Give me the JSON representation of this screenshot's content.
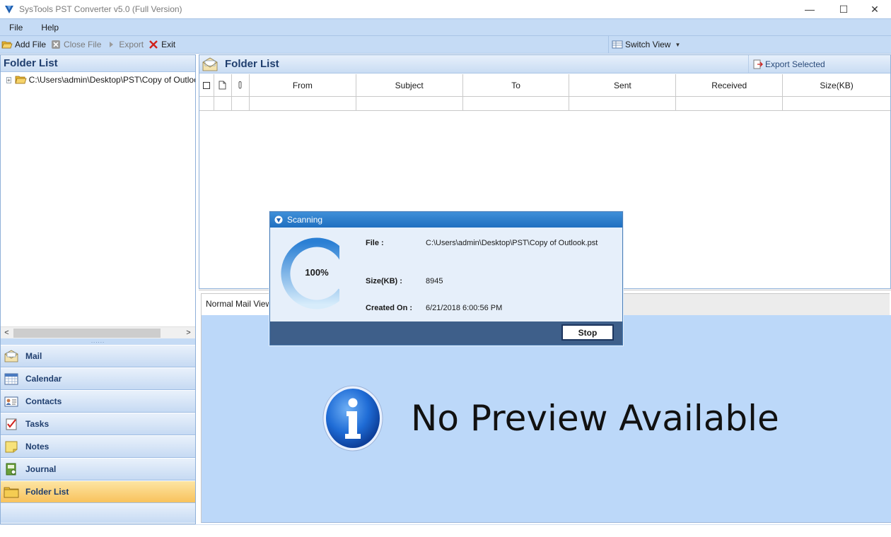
{
  "window": {
    "title": "SysTools  PST Converter v5.0 (Full Version)",
    "minimize_glyph": "—",
    "maximize_glyph": "☐",
    "close_glyph": "✕"
  },
  "menu": [
    "File",
    "Help"
  ],
  "toolbar": {
    "add_file": "Add File",
    "close_file": "Close File",
    "export": "Export",
    "exit": "Exit",
    "switch_view": "Switch View"
  },
  "left_panel": {
    "header": "Folder List",
    "tree": [
      {
        "expander": "+",
        "label": "C:\\Users\\admin\\Desktop\\PST\\Copy of Outlook.pst"
      }
    ],
    "scroll_left": "<",
    "scroll_right": ">",
    "splitter_grip": "......",
    "nav": [
      {
        "label": "Mail",
        "icon": "mail-icon",
        "active": false
      },
      {
        "label": "Calendar",
        "icon": "calendar-icon",
        "active": false
      },
      {
        "label": "Contacts",
        "icon": "contacts-icon",
        "active": false
      },
      {
        "label": "Tasks",
        "icon": "tasks-icon",
        "active": false
      },
      {
        "label": "Notes",
        "icon": "notes-icon",
        "active": false
      },
      {
        "label": "Journal",
        "icon": "journal-icon",
        "active": false
      },
      {
        "label": "Folder List",
        "icon": "folder-icon",
        "active": true
      }
    ]
  },
  "right_panel": {
    "header": "Folder List",
    "export_selected": "Export Selected",
    "columns": [
      "From",
      "Subject",
      "To",
      "Sent",
      "Received",
      "Size(KB)"
    ]
  },
  "preview": {
    "tab": "Normal Mail View",
    "message": "No Preview Available"
  },
  "dialog": {
    "title": "Scanning",
    "progress": 100,
    "progress_label": "100%",
    "file_label": "File :",
    "file_value": "C:\\Users\\admin\\Desktop\\PST\\Copy of Outlook.pst",
    "size_label": "Size(KB) :",
    "size_value": "8945",
    "created_label": "Created On :",
    "created_value": "6/21/2018 6:00:56 PM",
    "stop": "Stop"
  },
  "colors": {
    "menu_bg": "#c5dbf5",
    "preview_bg": "#bcd8f9",
    "active_nav": "#f8c25c",
    "dialog_title": "#1f6fc0",
    "dialog_footer": "#3e5f8a",
    "exit_red": "#d0211b"
  }
}
